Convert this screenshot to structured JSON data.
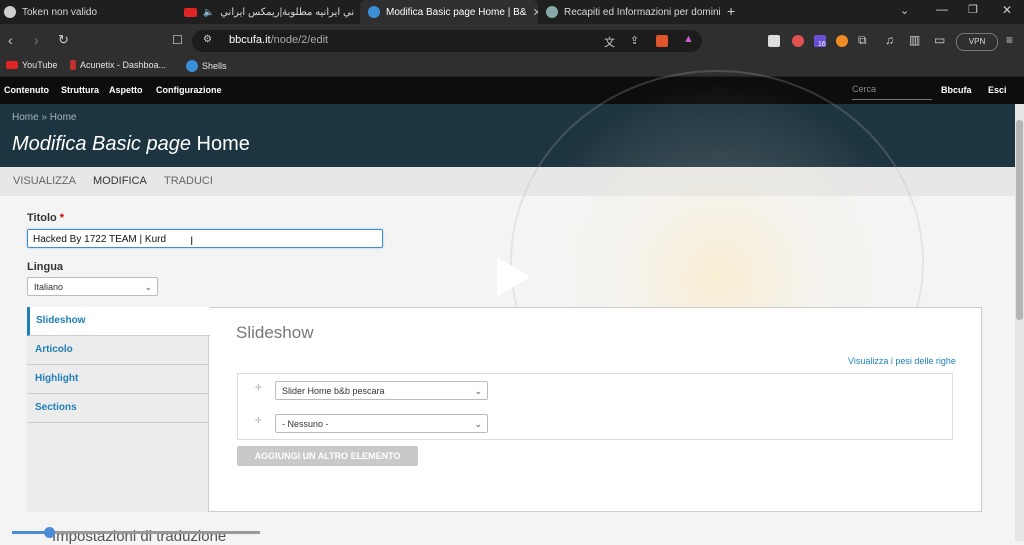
{
  "browser": {
    "tabs": [
      {
        "title": "Token non valido",
        "active": false
      },
      {
        "title": "اغاني ايرانيه مطلوبة|ريمكس ايراني",
        "active": false
      },
      {
        "title": "Modifica Basic page Home | B&",
        "active": true
      },
      {
        "title": "Recapiti ed Informazioni per domini",
        "active": false
      }
    ],
    "new_tab": "+",
    "url_host": "bbcufa.it",
    "url_path": "/node/2/edit",
    "vpn_label": "VPN",
    "badge_count": "16",
    "bookmarks": [
      "YouTube",
      "Acunetix - Dashboa...",
      "Shells"
    ]
  },
  "admin_toolbar": {
    "items": [
      "Contenuto",
      "Struttura",
      "Aspetto",
      "Configurazione"
    ],
    "search_placeholder": "Cerca",
    "user": "Bbcufa",
    "logout": "Esci"
  },
  "header": {
    "breadcrumb": "Home » Home",
    "title_prefix": "Modifica Basic page",
    "title_suffix": "Home"
  },
  "page_tabs": [
    "VISUALIZZA",
    "MODIFICA",
    "TRADUCI"
  ],
  "form": {
    "title_label": "Titolo",
    "required_mark": "*",
    "title_value": "Hacked By 1722 TEAM | Kurd",
    "language_label": "Lingua",
    "language_value": "Italiano",
    "vertical_tabs": [
      "Slideshow",
      "Articolo",
      "Highlight",
      "Sections"
    ],
    "pane_title": "Slideshow",
    "row_weights_link": "Visualizza i pesi delle righe",
    "slides": [
      "Slider Home b&b pescara",
      "- Nessuno -"
    ],
    "add_button": "AGGIUNGI UN ALTRO ELEMENTO",
    "translation_settings": "Impostazioni di traduzione"
  },
  "video": {
    "progress": 0.15
  },
  "colors": {
    "accent": "#1e7fb8",
    "header": "#1d3441",
    "admin_bar": "#0d0d0d"
  }
}
